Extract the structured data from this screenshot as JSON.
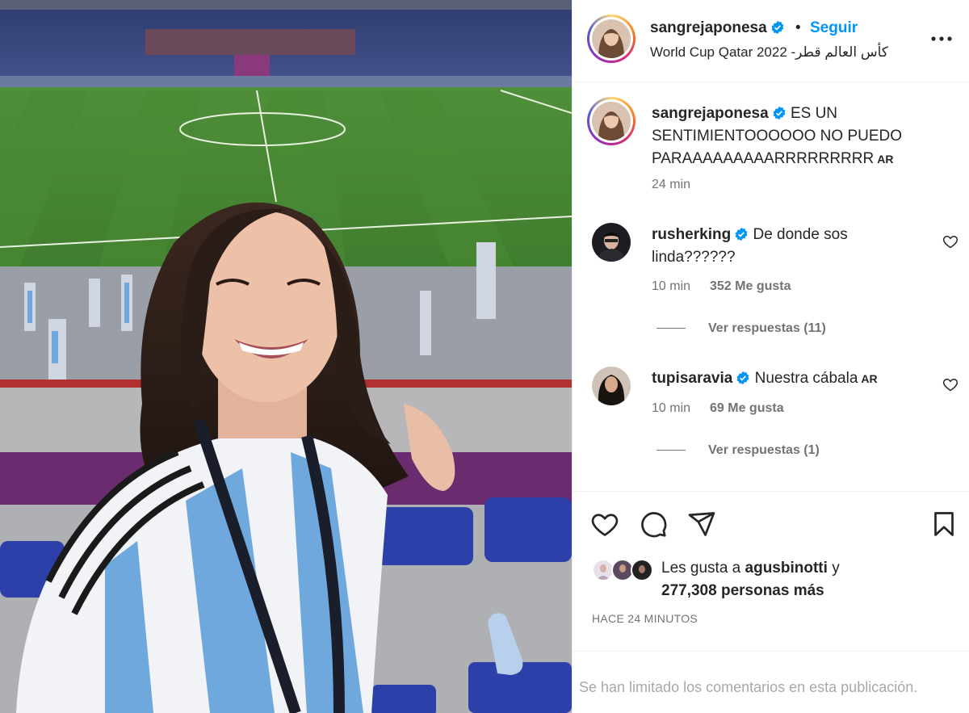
{
  "post": {
    "author": "sangrejaponesa",
    "dot": "•",
    "follow_label": "Seguir",
    "location": "World Cup Qatar 2022 -كأس العالم قطر",
    "caption_user": "sangrejaponesa",
    "caption_line1": "ES UN",
    "caption_line2": "SENTIMIENTOOOOOO NO PUEDO",
    "caption_line3": "PARAAAAAAAAARRRRRRRRR",
    "caption_flag": "AR",
    "caption_time": "24 min"
  },
  "comments": [
    {
      "user": "rusherking",
      "text_line1": "De donde sos",
      "text_line2": "linda??????",
      "time": "10 min",
      "likes": "352 Me gusta",
      "replies": "Ver respuestas (11)"
    },
    {
      "user": "tupisaravia",
      "text_line1": "Nuestra cábala",
      "flag": "AR",
      "time": "10 min",
      "likes": "69 Me gusta",
      "replies": "Ver respuestas (1)"
    }
  ],
  "likes": {
    "prefix": "Les gusta a",
    "user": "agusbinotti",
    "conj": "y",
    "count": "277,308 personas más"
  },
  "timestamp": "HACE 24 MINUTOS",
  "limited_notice": "Se han limitado los comentarios en esta publicación.",
  "icons": {
    "like": "heart-icon",
    "comment": "comment-icon",
    "share": "paper-plane-icon",
    "save": "bookmark-icon",
    "more": "more-options-icon",
    "verified": "verified-badge-icon"
  },
  "colors": {
    "follow": "#0095f6",
    "verified": "#0095f6",
    "secondary_text": "#737373",
    "muted_text": "#a8a8a8"
  }
}
